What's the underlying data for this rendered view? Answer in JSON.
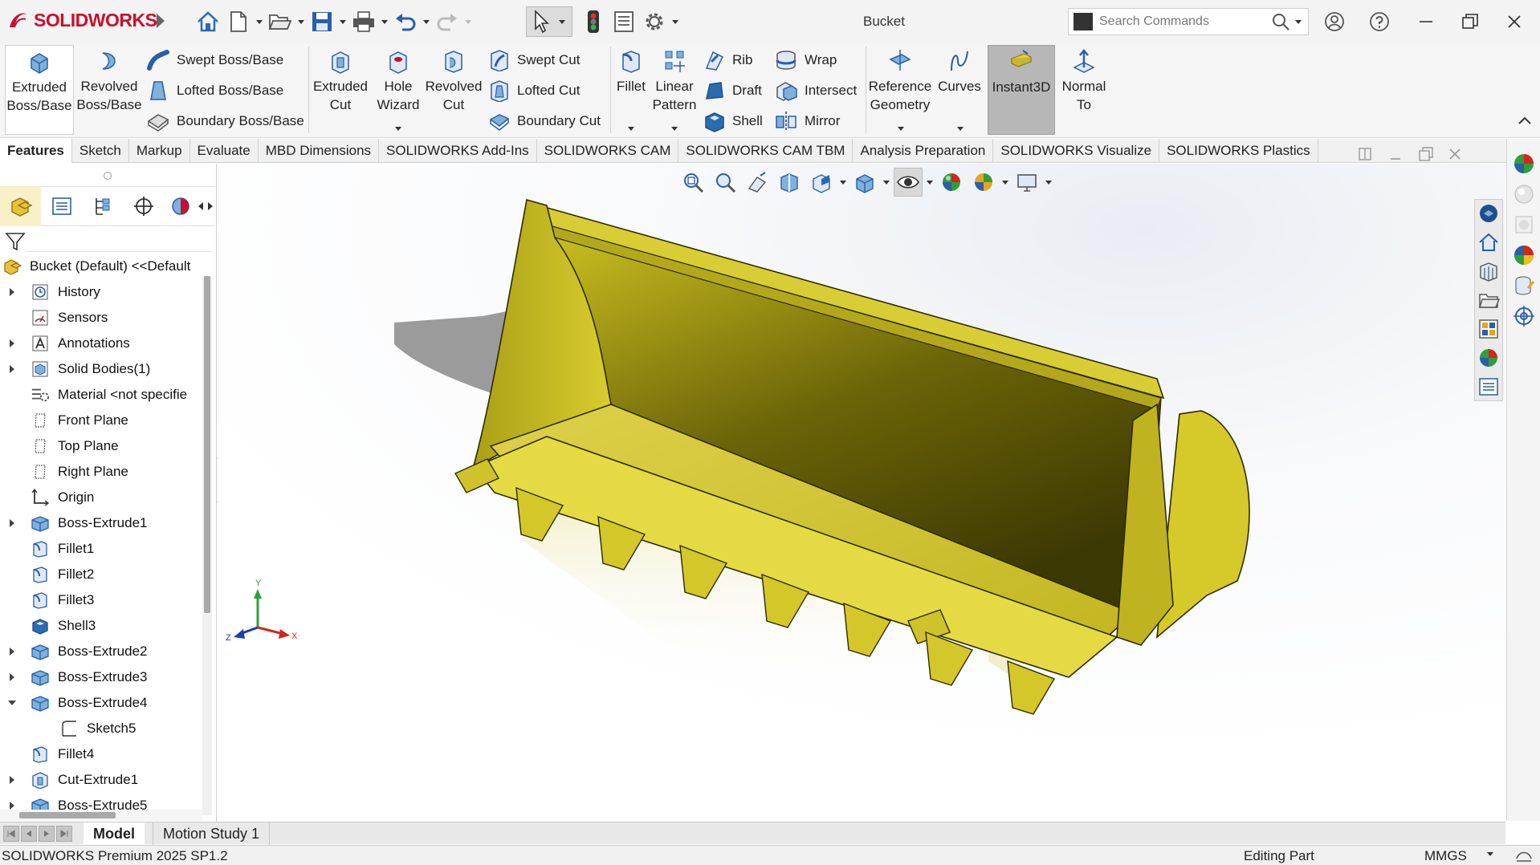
{
  "app": {
    "logo_text": "SOLIDWORKS",
    "document_title": "Bucket",
    "search_placeholder": "Search Commands",
    "colors": {
      "brand": "#c8102e",
      "model": "#c9c21c",
      "accent": "#0b6db5"
    }
  },
  "ribbon": {
    "extruded_boss": "Extruded\nBoss/Base",
    "revolved_boss": "Revolved\nBoss/Base",
    "swept_boss": "Swept Boss/Base",
    "lofted_boss": "Lofted Boss/Base",
    "boundary_boss": "Boundary Boss/Base",
    "extruded_cut": "Extruded\nCut",
    "hole_wizard": "Hole\nWizard",
    "revolved_cut": "Revolved\nCut",
    "swept_cut": "Swept Cut",
    "lofted_cut": "Lofted Cut",
    "boundary_cut": "Boundary Cut",
    "fillet": "Fillet",
    "linear_pattern": "Linear\nPattern",
    "rib": "Rib",
    "draft": "Draft",
    "shell": "Shell",
    "wrap": "Wrap",
    "intersect": "Intersect",
    "mirror": "Mirror",
    "reference_geometry": "Reference\nGeometry",
    "curves": "Curves",
    "instant3d": "Instant3D",
    "normal_to": "Normal\nTo"
  },
  "tabs": [
    "Features",
    "Sketch",
    "Markup",
    "Evaluate",
    "MBD Dimensions",
    "SOLIDWORKS Add-Ins",
    "SOLIDWORKS CAM",
    "SOLIDWORKS CAM TBM",
    "Analysis Preparation",
    "SOLIDWORKS Visualize",
    "SOLIDWORKS Plastics"
  ],
  "tree": {
    "root": "Bucket (Default) <<Default",
    "items": [
      {
        "label": "History",
        "icon": "history-icon",
        "expand": "closed",
        "indent": 0
      },
      {
        "label": "Sensors",
        "icon": "sensors-icon",
        "expand": "",
        "indent": 0
      },
      {
        "label": "Annotations",
        "icon": "annotations-icon",
        "expand": "closed",
        "indent": 0
      },
      {
        "label": "Solid Bodies(1)",
        "icon": "solid-bodies-icon",
        "expand": "closed",
        "indent": 0
      },
      {
        "label": "Material <not specifie",
        "icon": "material-icon",
        "expand": "",
        "indent": 0
      },
      {
        "label": "Front Plane",
        "icon": "plane-icon",
        "expand": "",
        "indent": 0
      },
      {
        "label": "Top Plane",
        "icon": "plane-icon",
        "expand": "",
        "indent": 0
      },
      {
        "label": "Right Plane",
        "icon": "plane-icon",
        "expand": "",
        "indent": 0
      },
      {
        "label": "Origin",
        "icon": "origin-icon",
        "expand": "",
        "indent": 0
      },
      {
        "label": "Boss-Extrude1",
        "icon": "extrude-feature-icon",
        "expand": "closed",
        "indent": 0
      },
      {
        "label": "Fillet1",
        "icon": "fillet-feature-icon",
        "expand": "",
        "indent": 0
      },
      {
        "label": "Fillet2",
        "icon": "fillet-feature-icon",
        "expand": "",
        "indent": 0
      },
      {
        "label": "Fillet3",
        "icon": "fillet-feature-icon",
        "expand": "",
        "indent": 0
      },
      {
        "label": "Shell3",
        "icon": "shell-feature-icon",
        "expand": "",
        "indent": 0
      },
      {
        "label": "Boss-Extrude2",
        "icon": "extrude-feature-icon",
        "expand": "closed",
        "indent": 0
      },
      {
        "label": "Boss-Extrude3",
        "icon": "extrude-feature-icon",
        "expand": "closed",
        "indent": 0
      },
      {
        "label": "Boss-Extrude4",
        "icon": "extrude-feature-icon",
        "expand": "open",
        "indent": 0
      },
      {
        "label": "Sketch5",
        "icon": "sketch-icon",
        "expand": "",
        "indent": 1
      },
      {
        "label": "Fillet4",
        "icon": "fillet-feature-icon",
        "expand": "",
        "indent": 0
      },
      {
        "label": "Cut-Extrude1",
        "icon": "cut-feature-icon",
        "expand": "closed",
        "indent": 0
      },
      {
        "label": "Boss-Extrude5",
        "icon": "extrude-feature-icon",
        "expand": "closed",
        "indent": 0
      }
    ]
  },
  "triad": {
    "x": "X",
    "y": "Y",
    "z": "Z"
  },
  "bottom_tabs": [
    "Model",
    "Motion Study 1"
  ],
  "status": {
    "product": "SOLIDWORKS Premium 2025 SP1.2",
    "mode": "Editing Part",
    "units": "MMGS"
  }
}
